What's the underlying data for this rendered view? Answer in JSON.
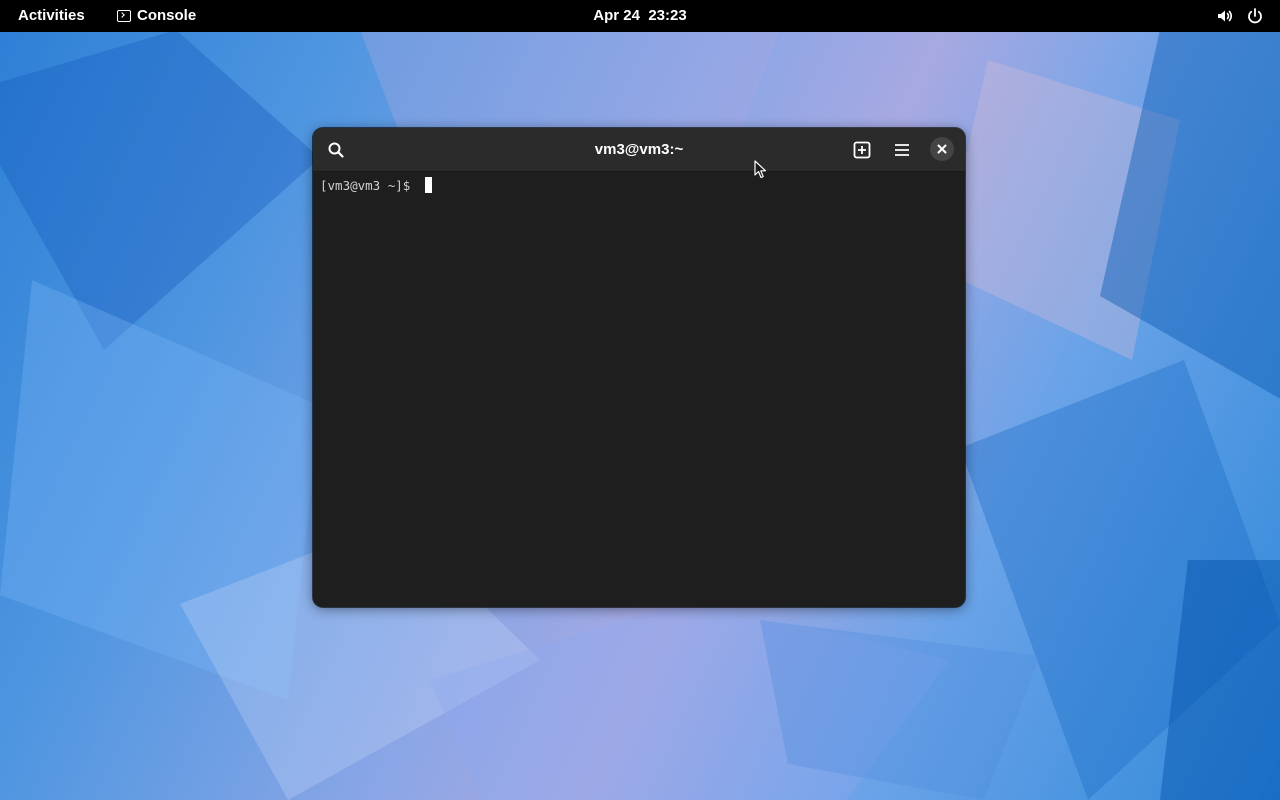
{
  "topbar": {
    "activities_label": "Activities",
    "app_menu_label": "Console",
    "clock": "Apr 24  23:23",
    "tray_icons": [
      "volume-icon",
      "power-icon"
    ]
  },
  "window": {
    "title": "vm3@vm3:~",
    "header_icons": [
      "search-icon",
      "new-tab-icon",
      "hamburger-menu-icon",
      "close-icon"
    ],
    "terminal": {
      "prompt": "[vm3@vm3 ~]$ "
    }
  },
  "colors": {
    "topbar_bg": "#000000",
    "headerbar_bg": "#2b2b2b",
    "terminal_bg": "#1e1e1e",
    "terminal_fg": "#d0d0d0"
  }
}
